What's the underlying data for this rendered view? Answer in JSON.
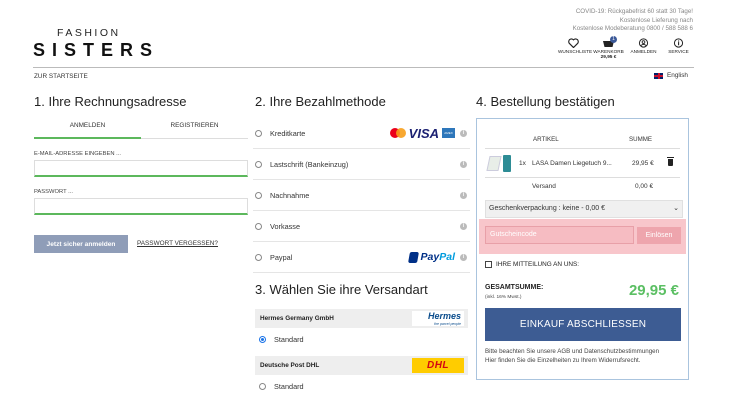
{
  "brand": {
    "top": "FASHION",
    "main": "SISTERS"
  },
  "notice": [
    "COVID-19: Rückgabefrist 60 statt 30 Tage!",
    "Kostenlose Lieferung nach",
    "Kostenlose Modeberatung 0800 / 588 588 6"
  ],
  "header": {
    "wishlist": "WUNSCHLISTE",
    "cart": "WARENKORB",
    "cart_count": "1",
    "cart_price": "29,95 €",
    "login": "ANMELDEN",
    "service": "SERVICE"
  },
  "breadcrumb": "ZUR STARTSEITE",
  "language": "English",
  "billing": {
    "title": "1. Ihre Rechnungsadresse",
    "tab_login": "ANMELDEN",
    "tab_register": "REGISTRIEREN",
    "email_label": "E-MAIL-ADRESSE EINGEBEN ...",
    "password_label": "PASSWORT ...",
    "login_button": "Jetzt sicher anmelden",
    "forgot": "PASSWORT VERGESSEN?"
  },
  "payment": {
    "title": "2. Ihre Bezahlmethode",
    "methods": [
      "Kreditkarte",
      "Lastschrift (Bankeinzug)",
      "Nachnahme",
      "Vorkasse",
      "Paypal"
    ],
    "visa": "VISA",
    "amex": "AMEX",
    "paypal_a": "Pay",
    "paypal_b": "Pal"
  },
  "shipping": {
    "title": "3. Wählen Sie ihre Versandart",
    "carrier1": "Hermes Germany GmbH",
    "hermes_logo": "Hermes",
    "hermes_tag": "the parcel people",
    "carrier1_option": "Standard",
    "carrier2": "Deutsche Post DHL",
    "dhl_logo": "DHL",
    "carrier2_option": "Standard"
  },
  "order": {
    "title": "4. Bestellung bestätigen",
    "col_article": "ARTIKEL",
    "col_sum": "SUMME",
    "item_qty": "1x",
    "item_name": "LASA Damen Liegetuch 9...",
    "item_price": "29,95 €",
    "shipping_label": "Versand",
    "shipping_price": "0,00 €",
    "gift_wrap": "Geschenkverpackung : keine - 0,00 €",
    "voucher_placeholder": "Gutscheincode",
    "voucher_button": "Einlösen",
    "no_message": "IHRE MITTEILUNG AN UNS:",
    "total_label": "GESAMTSUMME:",
    "total_sub": "(inkl. 16% Mwst.)",
    "total_value": "29,95 €",
    "buy_button": "EINKAUF ABSCHLIESSEN",
    "legal_1": "Bitte beachten Sie unsere AGB und Datenschutzbestimmungen",
    "legal_2": "Hier finden Sie die Einzelheiten zu Ihrem Widerrufsrecht."
  }
}
